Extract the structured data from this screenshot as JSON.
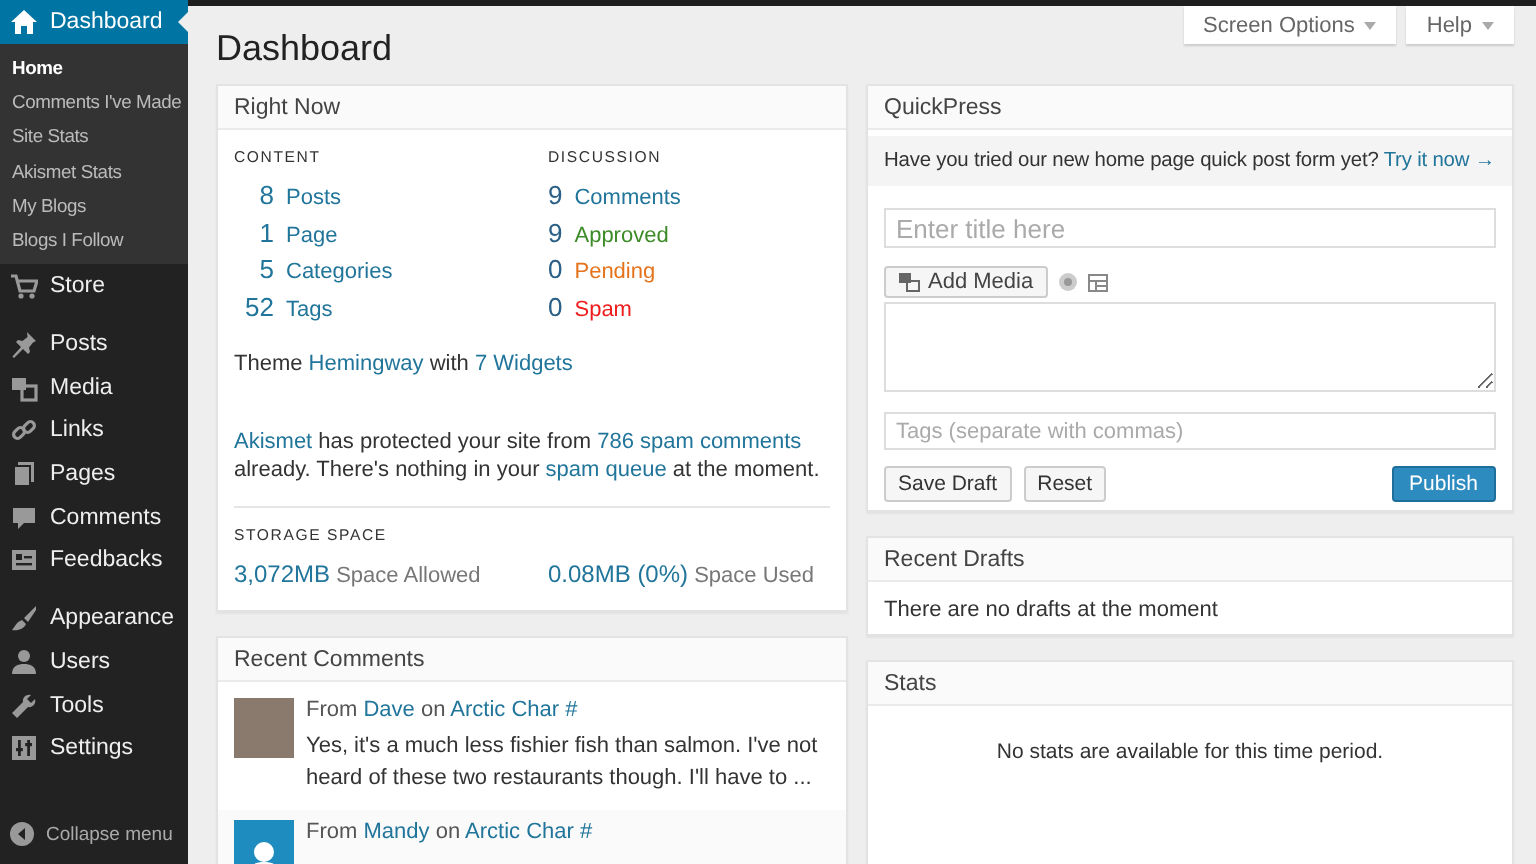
{
  "top_buttons": [
    {
      "label": "Screen Options"
    },
    {
      "label": "Help"
    }
  ],
  "page_title": "Dashboard",
  "sidebar": {
    "groups": [
      {
        "items": [
          {
            "label": "Dashboard",
            "selected": true,
            "children": [
              {
                "label": "Home",
                "selected": true
              },
              {
                "label": "Comments I've Made",
                "selected": false
              },
              {
                "label": "Site Stats",
                "selected": false
              },
              {
                "label": "Akismet Stats",
                "selected": false
              },
              {
                "label": "My Blogs",
                "selected": false
              },
              {
                "label": "Blogs I Follow",
                "selected": false
              }
            ]
          },
          {
            "label": "Store",
            "selected": false
          }
        ]
      },
      {
        "items": [
          {
            "label": "Posts",
            "selected": false
          },
          {
            "label": "Media",
            "selected": false
          },
          {
            "label": "Links",
            "selected": false
          },
          {
            "label": "Pages",
            "selected": false
          },
          {
            "label": "Comments",
            "selected": false
          },
          {
            "label": "Feedbacks",
            "selected": false
          }
        ]
      },
      {
        "items": [
          {
            "label": "Appearance",
            "selected": false
          },
          {
            "label": "Users",
            "selected": false
          },
          {
            "label": "Tools",
            "selected": false
          },
          {
            "label": "Settings",
            "selected": false
          }
        ]
      }
    ],
    "collapse": "Collapse menu"
  },
  "right_now": {
    "title": "Right Now",
    "content": {
      "heading": "CONTENT",
      "rows": [
        {
          "count": "8",
          "label": "Posts"
        },
        {
          "count": "1",
          "label": "Page"
        },
        {
          "count": "5",
          "label": "Categories"
        },
        {
          "count": "52",
          "label": "Tags"
        }
      ]
    },
    "discussion": {
      "heading": "DISCUSSION",
      "rows": [
        {
          "count": "9",
          "label": "Comments",
          "color": "#21759b"
        },
        {
          "count": "9",
          "label": "Approved",
          "color": "#3d8b27"
        },
        {
          "count": "0",
          "label": "Pending",
          "color": "#e5731b"
        },
        {
          "count": "0",
          "label": "Spam",
          "color": "#ee1c1c"
        }
      ]
    },
    "theme_line": [
      {
        "text": "Theme ",
        "link": false
      },
      {
        "text": "Hemingway",
        "link": true
      },
      {
        "text": " with ",
        "link": false
      },
      {
        "text": "7 Widgets",
        "link": true
      }
    ],
    "akismet": [
      {
        "text": "Akismet",
        "link": true
      },
      {
        "text": " has protected your site from ",
        "link": false
      },
      {
        "text": "786 spam comments",
        "link": true
      },
      {
        "text": " already. There's nothing in your ",
        "link": false
      },
      {
        "text": "spam queue",
        "link": true
      },
      {
        "text": " at the moment.",
        "link": false
      }
    ],
    "storage": {
      "heading": "STORAGE SPACE",
      "items": [
        {
          "value": "3,072MB",
          "label": "Space Allowed"
        },
        {
          "value": "0.08MB (0%)",
          "label": "Space Used"
        }
      ]
    }
  },
  "recent_comments": {
    "title": "Recent Comments",
    "comments": [
      {
        "kind": "photo",
        "byline": [
          {
            "text": "From ",
            "link": false
          },
          {
            "text": "Dave",
            "link": true
          },
          {
            "text": " on ",
            "link": false
          },
          {
            "text": "Arctic Char #",
            "link": true
          }
        ],
        "text": "Yes, it's a much less fishier fish than salmon. I've not heard of these two restaurants though. I'll have to ..."
      },
      {
        "kind": "default",
        "byline": [
          {
            "text": "From ",
            "link": false
          },
          {
            "text": "Mandy",
            "link": true
          },
          {
            "text": " on ",
            "link": false
          },
          {
            "text": "Arctic Char #",
            "link": true
          }
        ]
      }
    ]
  },
  "quickpress": {
    "title": "QuickPress",
    "notice": {
      "text": "Have you tried our new home page quick post form yet?",
      "link": "Try it now →"
    },
    "title_field": {
      "placeholder": "Enter title here"
    },
    "add_media": "Add Media",
    "tags_field": {
      "placeholder": "Tags (separate with commas)"
    },
    "buttons": [
      {
        "label": "Save Draft",
        "kind": "secondary"
      },
      {
        "label": "Reset",
        "kind": "secondary"
      },
      {
        "label": "Publish",
        "kind": "primary"
      }
    ]
  },
  "recent_drafts": {
    "title": "Recent Drafts",
    "message": "There are no drafts at the moment"
  },
  "stats": {
    "title": "Stats",
    "message": "No stats are available for this time period."
  }
}
